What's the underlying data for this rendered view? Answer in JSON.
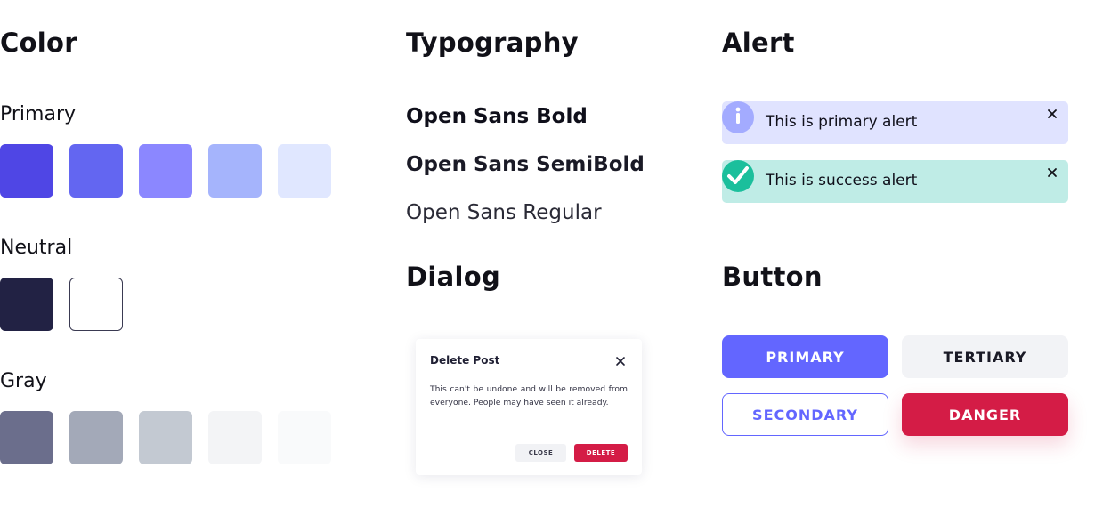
{
  "color_section": {
    "title": "Color",
    "primary": {
      "label": "Primary",
      "colors": [
        "#4f46e5",
        "#6366f1",
        "#8b87ff",
        "#a5b4fc",
        "#e0e7ff"
      ]
    },
    "neutral": {
      "label": "Neutral",
      "colors": [
        "#222244",
        "#ffffff"
      ]
    },
    "gray": {
      "label": "Gray",
      "colors": [
        "#6b6e8c",
        "#a3a9b8",
        "#c3c9d2",
        "#f3f4f6",
        "#f9fafb"
      ]
    }
  },
  "typography_section": {
    "title": "Typography",
    "samples": [
      "Open Sans Bold",
      "Open Sans SemiBold",
      "Open Sans Regular"
    ]
  },
  "dialog_section": {
    "title": "Dialog",
    "dialog": {
      "title": "Delete Post",
      "body": "This can't be undone and will be removed from everyone. People may have seen it already.",
      "close_label": "CLOSE",
      "delete_label": "DELETE"
    }
  },
  "alert_section": {
    "title": "Alert",
    "alerts": [
      {
        "text": "This is primary alert",
        "icon": "info-icon",
        "bg": "#e0e3ff",
        "icon_color": "#a3abff"
      },
      {
        "text": "This is success alert",
        "icon": "check-icon",
        "bg": "#bfece6",
        "icon_color": "#1bbf9c"
      }
    ]
  },
  "button_section": {
    "title": "Button",
    "primary_label": "PRIMARY",
    "tertiary_label": "TERTIARY",
    "secondary_label": "SECONDARY",
    "danger_label": "DANGER"
  }
}
